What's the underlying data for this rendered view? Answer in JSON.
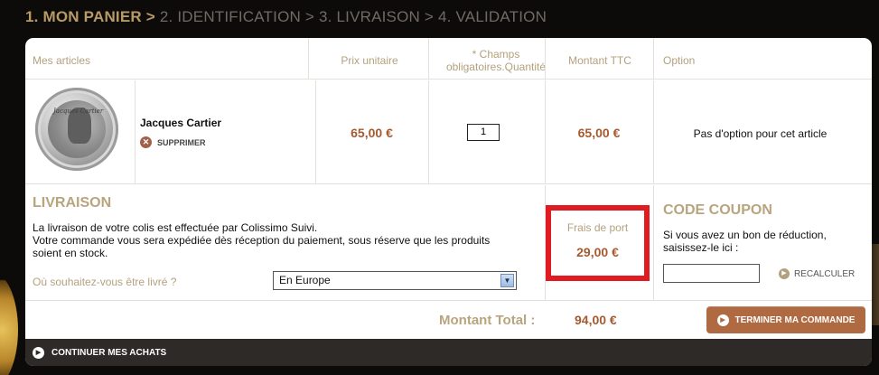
{
  "steps": {
    "step1": "1. MON PANIER",
    "sep": ">",
    "step2": "2. IDENTIFICATION",
    "step3": "3. LIVRAISON",
    "step4": "4. VALIDATION"
  },
  "table_headers": {
    "articles": "Mes articles",
    "prix": "Prix unitaire",
    "qty_line1": "* Champs",
    "qty_line2": "obligatoires.Quantité",
    "montant": "Montant TTC",
    "option": "Option"
  },
  "product": {
    "coin_script": "Jacques Cartier",
    "name": "Jacques Cartier",
    "remove_label": "SUPPRIMER",
    "unit_price": "65,00 €",
    "quantity": "1",
    "total": "65,00 €",
    "option_text": "Pas d'option pour cet article"
  },
  "livraison": {
    "title": "LIVRAISON",
    "text_line1": "La livraison de votre colis est effectuée par Colissimo Suivi.",
    "text_line2": "Votre commande vous sera expédiée dès réception du paiement, sous réserve que les produits soient en stock.",
    "question": "Où souhaitez-vous être livré ?",
    "selected_destination": "En Europe"
  },
  "frais": {
    "label": "Frais de port",
    "value": "29,00 €"
  },
  "coupon": {
    "title": "CODE COUPON",
    "text": "Si vous avez un bon de réduction, saisissez-le ici :",
    "input_value": "",
    "recalc_label": "RECALCULER"
  },
  "total": {
    "label": "Montant Total :",
    "value": "94,00 €"
  },
  "actions": {
    "terminer_label": "TERMINER MA COMMANDE",
    "continuer_label": "CONTINUER MES ACHATS"
  },
  "icons": {
    "remove": "close-circle-icon",
    "play": "play-circle-icon",
    "dropdown": "chevron-down-icon"
  },
  "colors": {
    "accent_gold": "#b8a57e",
    "price_brown": "#a55a2f",
    "button_brown": "#b06a42",
    "highlight_red": "#e11b22",
    "footer_dark": "#2d2a27"
  }
}
